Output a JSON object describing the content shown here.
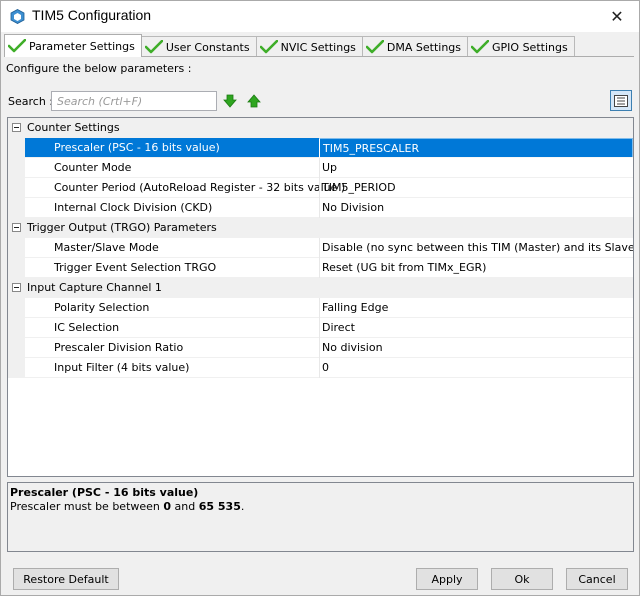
{
  "window": {
    "title": "TIM5 Configuration"
  },
  "tabs": [
    {
      "label": "Parameter Settings",
      "active": true
    },
    {
      "label": "User Constants",
      "active": false
    },
    {
      "label": "NVIC Settings",
      "active": false
    },
    {
      "label": "DMA Settings",
      "active": false
    },
    {
      "label": "GPIO Settings",
      "active": false
    }
  ],
  "configure_label": "Configure the below parameters :",
  "search": {
    "label": "Search :",
    "placeholder": "Search (Crtl+F)"
  },
  "groups": [
    {
      "name": "Counter Settings",
      "rows": [
        {
          "name": "Prescaler (PSC - 16 bits value)",
          "value": "TIM5_PRESCALER",
          "selected": true
        },
        {
          "name": "Counter Mode",
          "value": "Up"
        },
        {
          "name": "Counter Period (AutoReload Register - 32 bits value )",
          "value": "TIM5_PERIOD"
        },
        {
          "name": "Internal Clock Division (CKD)",
          "value": "No Division"
        }
      ]
    },
    {
      "name": "Trigger Output (TRGO) Parameters",
      "rows": [
        {
          "name": "Master/Slave Mode",
          "value": "Disable (no sync between this TIM (Master) and its Slaves"
        },
        {
          "name": "Trigger Event Selection TRGO",
          "value": "Reset (UG bit from TIMx_EGR)"
        }
      ]
    },
    {
      "name": "Input Capture Channel 1",
      "rows": [
        {
          "name": "Polarity Selection",
          "value": "Falling Edge"
        },
        {
          "name": "IC Selection",
          "value": "Direct"
        },
        {
          "name": "Prescaler Division Ratio",
          "value": "No division"
        },
        {
          "name": "Input Filter (4 bits value)",
          "value": "0"
        }
      ]
    }
  ],
  "description": {
    "title": "Prescaler (PSC - 16 bits value)",
    "text_prefix": "Prescaler must be between ",
    "min": "0",
    "text_middle": " and ",
    "max": "65 535",
    "text_suffix": "."
  },
  "buttons": {
    "restore_default": "Restore Default",
    "apply": "Apply",
    "ok": "Ok",
    "cancel": "Cancel"
  },
  "colors": {
    "selection": "#0078d7",
    "check_green": "#3fae29",
    "arrow_green": "#2ea51f"
  },
  "icons": {
    "title": "cube-icon",
    "tab": "green-check-icon",
    "move_down": "green-arrow-down-icon",
    "move_up": "green-arrow-up-icon",
    "view": "list-view-icon"
  }
}
